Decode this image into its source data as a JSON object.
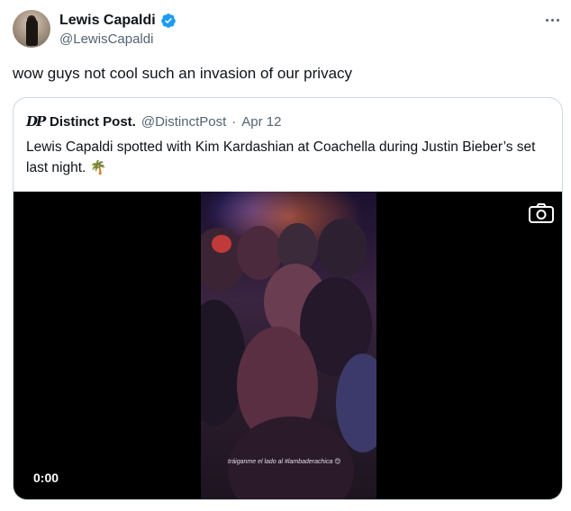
{
  "author": {
    "display_name": "Lewis Capaldi",
    "handle": "@LewisCapaldi",
    "verified_icon": "verified-badge-icon"
  },
  "tweet": {
    "text": "wow guys not cool such an invasion of our privacy"
  },
  "quote": {
    "logo_text": "DP",
    "display_name": "Distinct Post.",
    "handle": "@DistinctPost",
    "separator": "·",
    "date": "Apr 12",
    "text": "Lewis Capaldi spotted with Kim Kardashian at Coachella during Justin Bieber’s set last night.",
    "emoji": "🌴"
  },
  "media": {
    "timestamp": "0:00",
    "overlay_caption": "tráiganme el lado al #lambaderachica 😊"
  },
  "colors": {
    "text_primary": "#0f1419",
    "text_secondary": "#536471",
    "verified_blue": "#1d9bf0",
    "border": "#cfd9de"
  }
}
